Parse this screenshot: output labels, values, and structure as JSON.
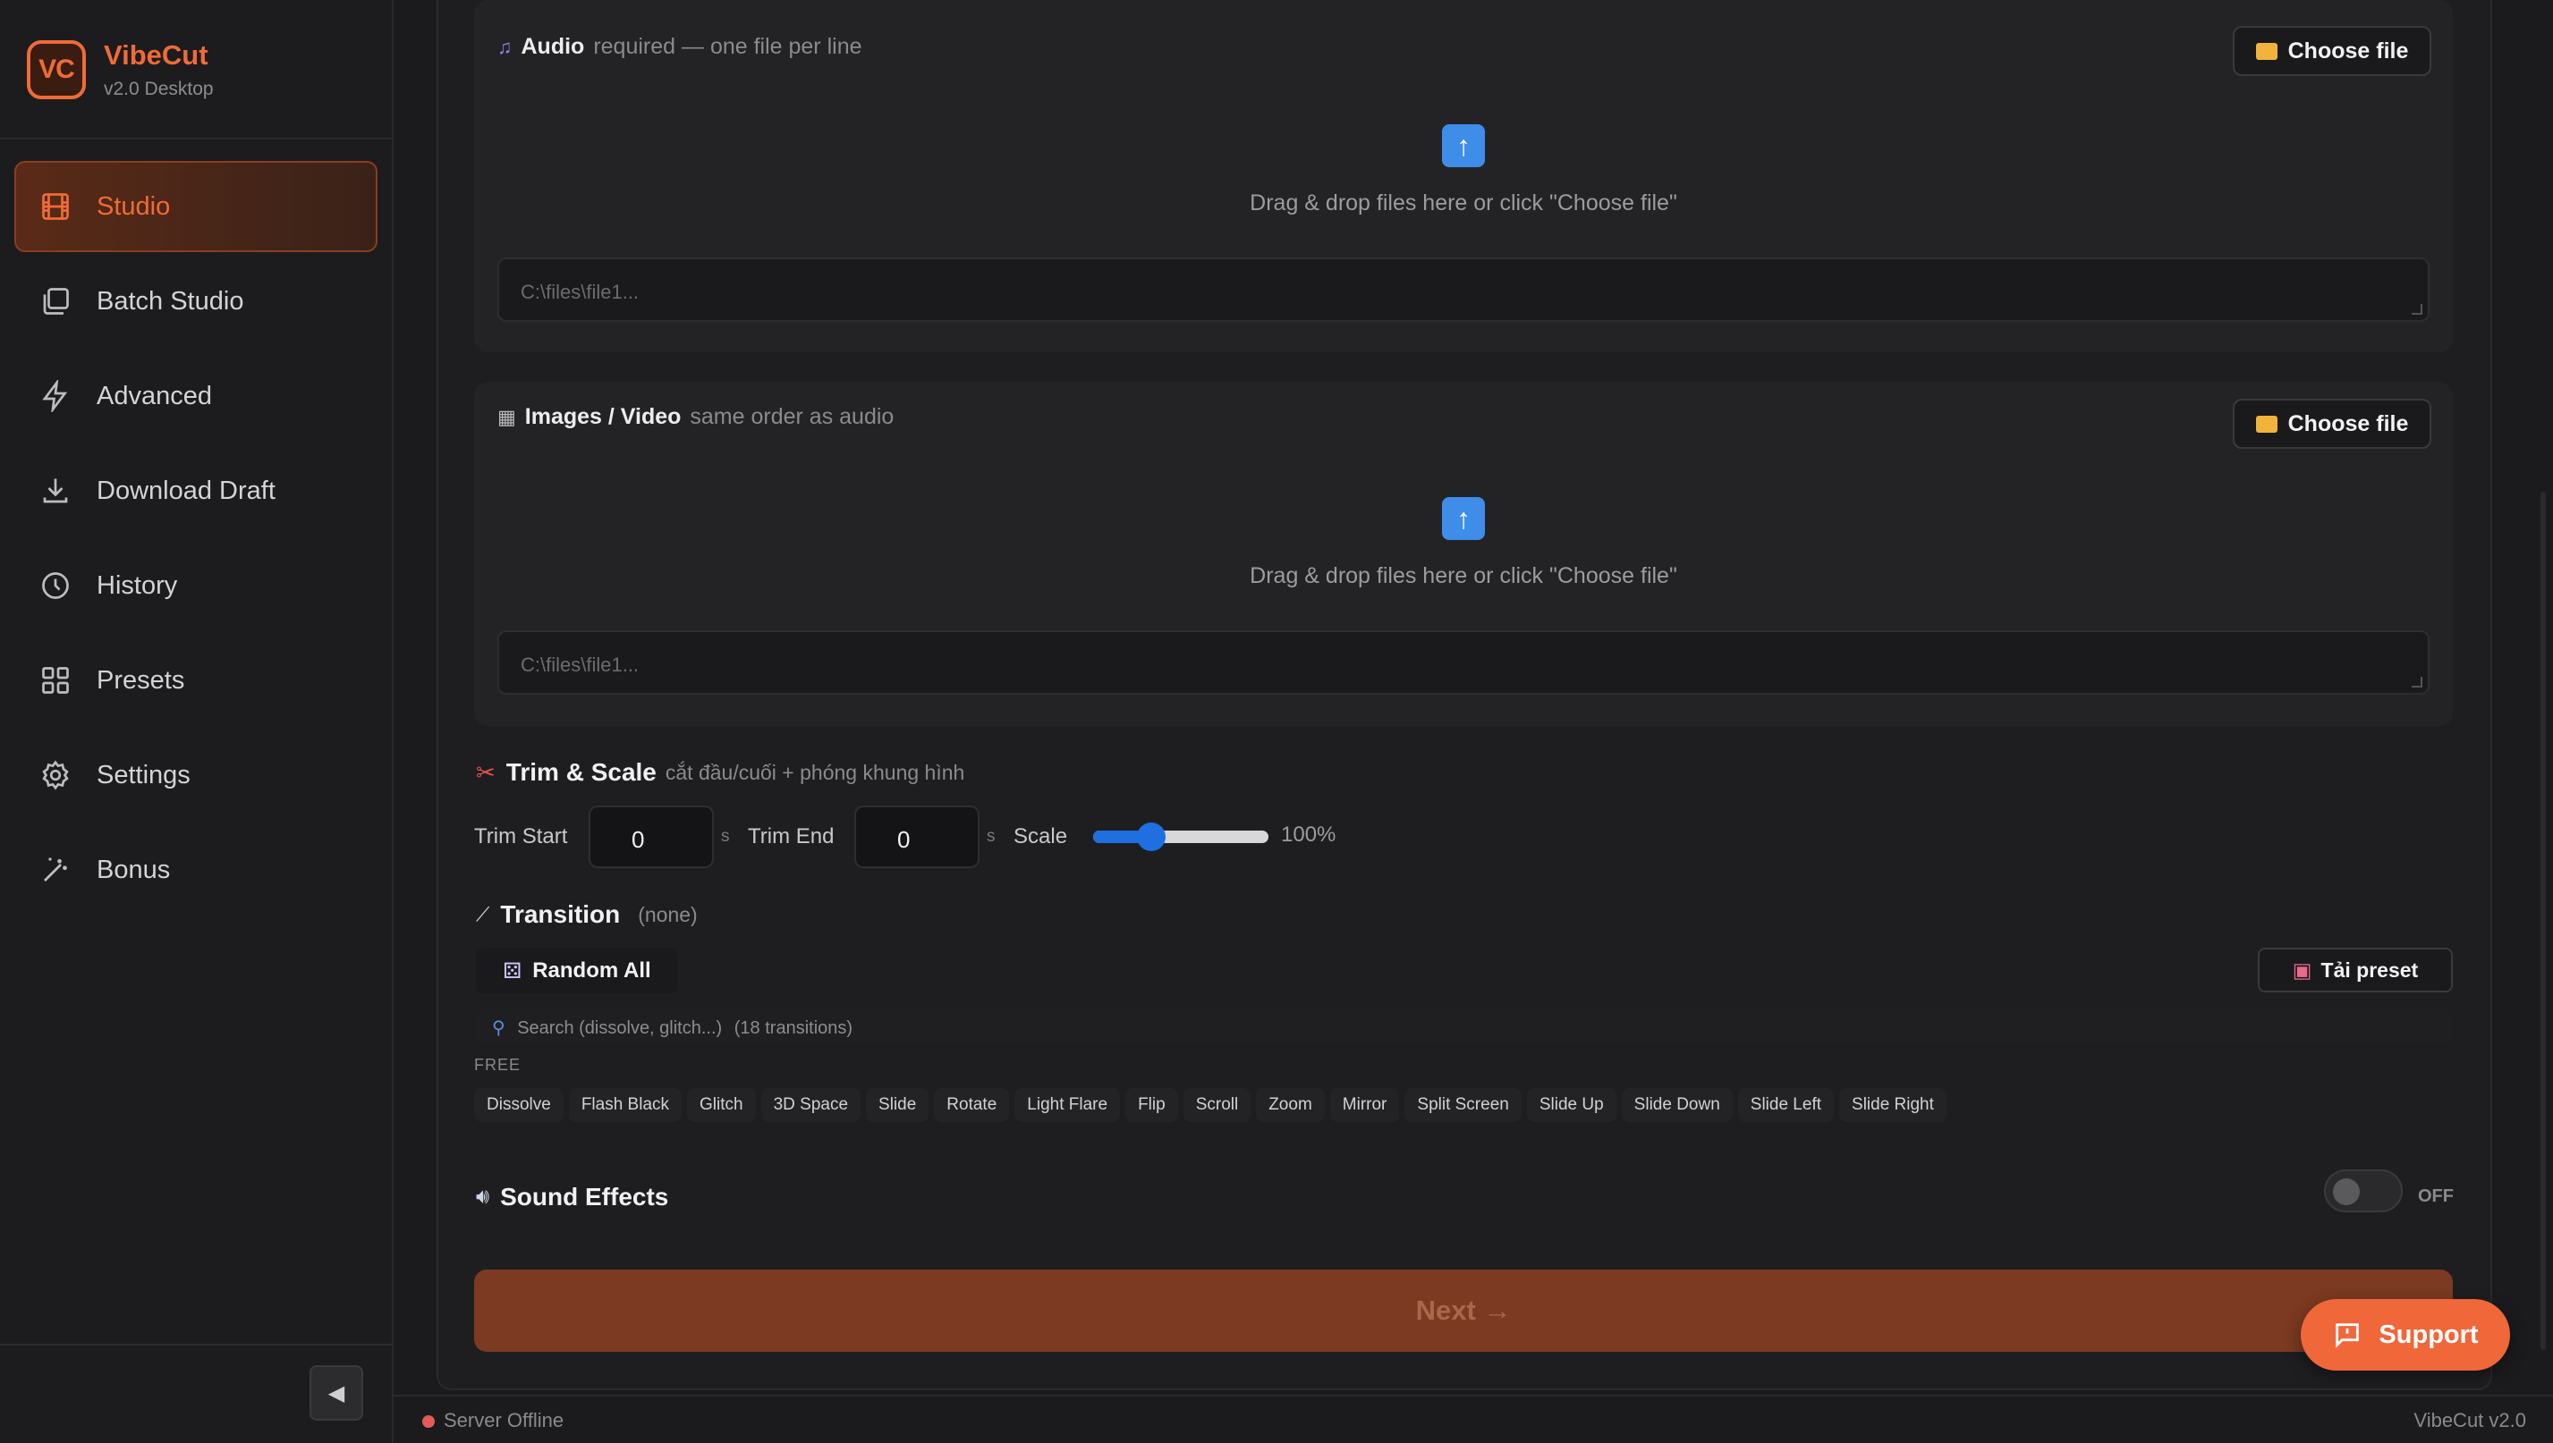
{
  "app": {
    "name": "VibeCut",
    "logo_text": "VC",
    "version_label": "v2.0 Desktop"
  },
  "sidebar": {
    "items": [
      {
        "label": "Studio",
        "icon": "film-icon",
        "active": true
      },
      {
        "label": "Batch Studio",
        "icon": "layers-icon"
      },
      {
        "label": "Advanced",
        "icon": "lightning-icon"
      },
      {
        "label": "Download Draft",
        "icon": "download-icon"
      },
      {
        "label": "History",
        "icon": "clock-icon"
      },
      {
        "label": "Presets",
        "icon": "grid-icon"
      },
      {
        "label": "Settings",
        "icon": "gear-icon"
      },
      {
        "label": "Bonus",
        "icon": "magic-wand-icon"
      }
    ],
    "collapse_glyph": "◀"
  },
  "audio": {
    "title": "Audio",
    "hint": "required — one file per line",
    "choose_label": "Choose file",
    "drop_text": "Drag & drop files here or click \"Choose file\"",
    "placeholder": "C:\\files\\file1..."
  },
  "media": {
    "title": "Images / Video",
    "hint": "same order as audio",
    "choose_label": "Choose file",
    "drop_text": "Drag & drop files here or click \"Choose file\"",
    "placeholder": "C:\\files\\file1..."
  },
  "trim": {
    "title": "Trim & Scale",
    "hint": "cắt đầu/cuối + phóng khung hình",
    "trim_start_label": "Trim Start",
    "trim_start_value": "0",
    "trim_end_label": "Trim End",
    "trim_end_value": "0",
    "unit": "s",
    "scale_label": "Scale",
    "scale_value": "100%",
    "scale_fraction": 0.33
  },
  "transition": {
    "title": "Transition",
    "current": "(none)",
    "random_label": "Random All",
    "preset_label": "Tải preset",
    "search_placeholder": "Search (dissolve, glitch...)",
    "count_label": "(18 transitions)",
    "group_label": "FREE",
    "items": [
      "Dissolve",
      "Flash Black",
      "Glitch",
      "3D Space",
      "Slide",
      "Rotate",
      "Light Flare",
      "Flip",
      "Scroll",
      "Zoom",
      "Mirror",
      "Split Screen",
      "Slide Up",
      "Slide Down",
      "Slide Left",
      "Slide Right"
    ]
  },
  "sound": {
    "title": "Sound Effects",
    "toggle_label": "OFF",
    "enabled": false
  },
  "actions": {
    "next_label": "Next →",
    "support_label": "Support"
  },
  "status": {
    "server": "Server Offline",
    "version": "VibeCut v2.0",
    "dot_color": "#e55a5a"
  },
  "colors": {
    "accent": "#f06b37",
    "slider": "#1f6fe0"
  }
}
